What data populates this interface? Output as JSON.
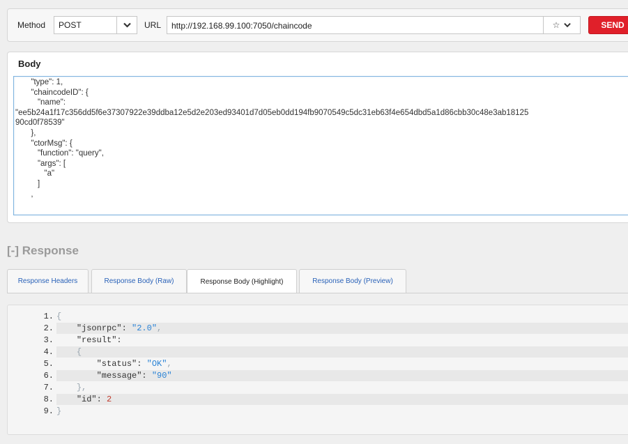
{
  "request": {
    "method_label": "Method",
    "method_value": "POST",
    "url_label": "URL",
    "url_value": "http://192.168.99.100:7050/chaincode",
    "send_label": "SEND"
  },
  "body": {
    "title": "Body",
    "lines": [
      "       \"type\": 1,",
      "       \"chaincodeID\": {",
      "          \"name\":",
      "\"ee5b24a1f17c356dd5f6e37307922e39ddba12e5d2e203ed93401d7d05eb0dd194fb9070549c5dc31eb63f4e654dbd5a1d86cbb30c48e3ab18125",
      "90cd0f78539\"",
      "       },",
      "       \"ctorMsg\": {",
      "          \"function\": \"query\",",
      "          \"args\": [",
      "             \"a\"",
      "          ]",
      "       ,"
    ]
  },
  "response": {
    "title": "[-] Response",
    "tabs": [
      {
        "label": "Response Headers"
      },
      {
        "label": "Response Body (Raw)"
      },
      {
        "label": "Response Body (Highlight)"
      },
      {
        "label": "Response Body (Preview)"
      }
    ],
    "code": {
      "n1": "1.",
      "n2": "2.",
      "n3": "3.",
      "n4": "4.",
      "n5": "5.",
      "n6": "6.",
      "n7": "7.",
      "n8": "8.",
      "n9": "9.",
      "open_brace": "{",
      "k_jsonrpc": "\"jsonrpc\"",
      "v_jsonrpc": "\"2.0\"",
      "k_result": "\"result\"",
      "inner_open": "{",
      "k_status": "\"status\"",
      "v_status": "\"OK\"",
      "k_message": "\"message\"",
      "v_message": "\"90\"",
      "inner_close": "},",
      "k_id": "\"id\"",
      "v_id": "2",
      "close_brace": "}"
    }
  },
  "colors": {
    "send_button": "#e0202a",
    "tab_link": "#2a62b8",
    "string_value": "#2a83d6",
    "number_value": "#c0392b"
  }
}
